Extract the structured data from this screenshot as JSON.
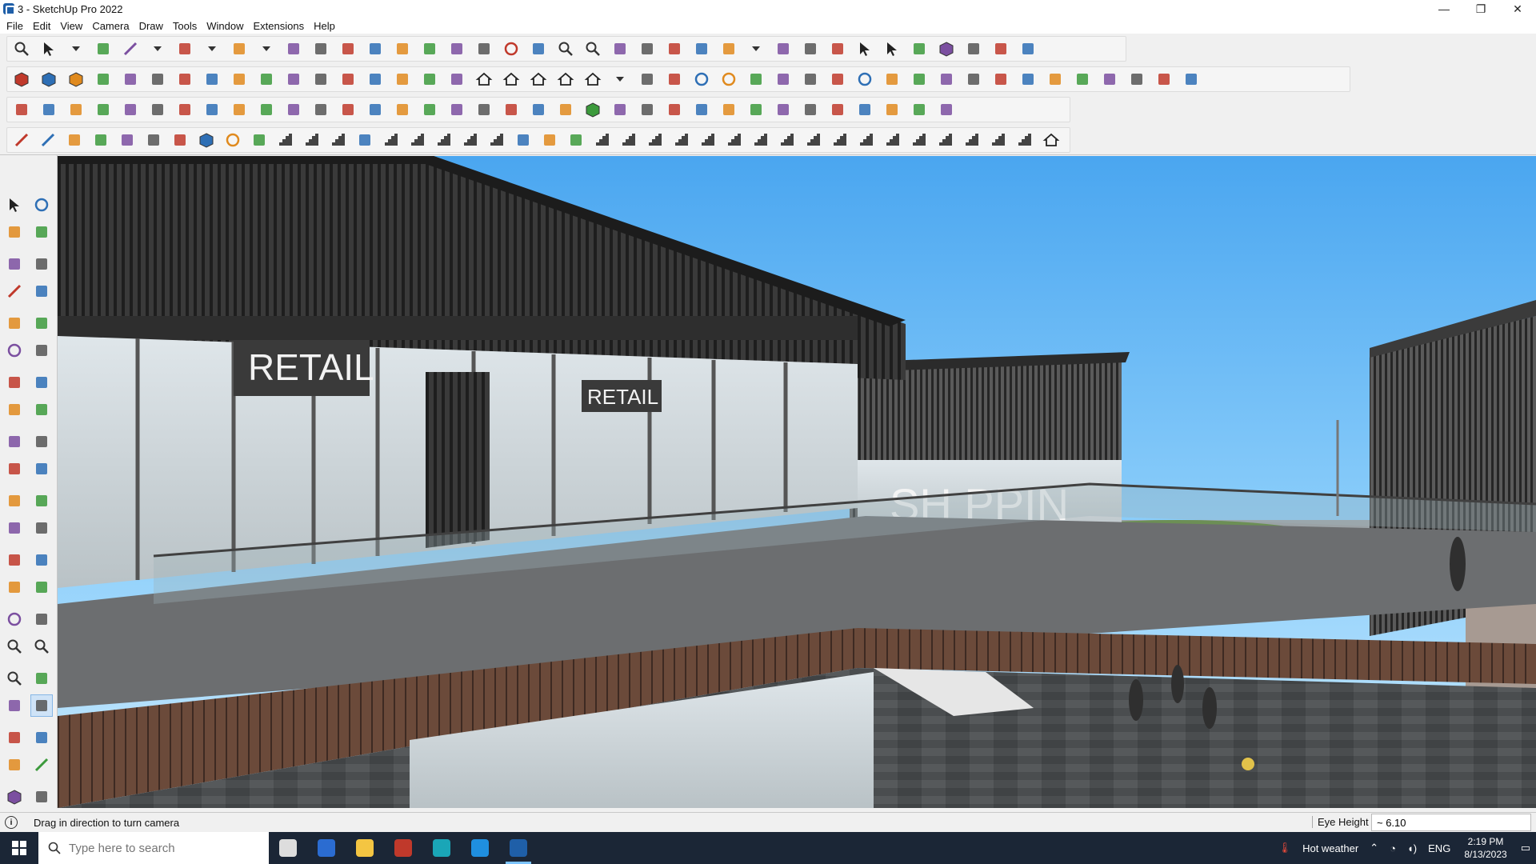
{
  "window": {
    "title": "3 - SketchUp Pro 2022",
    "controls": {
      "minimize": "—",
      "maximize": "❐",
      "close": "✕"
    }
  },
  "menu": [
    "File",
    "Edit",
    "View",
    "Camera",
    "Draw",
    "Tools",
    "Window",
    "Extensions",
    "Help"
  ],
  "viewport": {
    "signs": {
      "retail_large": "RETAIL",
      "retail_small": "RETAIL",
      "shopping": "SH PPIN"
    }
  },
  "statusbar": {
    "info_icon": "i",
    "hint": "Drag in direction to turn camera",
    "measurement_label": "Eye Height",
    "measurement_value": "~ 6.10"
  },
  "taskbar": {
    "search_placeholder": "Type here to search",
    "weather": "Hot weather",
    "language": "ENG",
    "time": "2:19 PM",
    "date": "8/13/2023"
  },
  "icons": {
    "toolbar_row1": [
      "zoom-icon",
      "select-arrow-icon",
      "dropdown-icon",
      "eraser-icon",
      "pencil-icon",
      "dropdown-icon",
      "lasso-icon",
      "dropdown-icon",
      "rect-icon",
      "dropdown-icon",
      "push-pull-icon",
      "follow-me-icon",
      "move-icon",
      "rotate-icon",
      "scale-icon",
      "tape-icon",
      "text-icon",
      "paint-icon",
      "orbit-icon",
      "pan-icon",
      "zoom-icon",
      "zoom-extents-icon",
      "camera-icon",
      "section-icon",
      "layers-icon",
      "tag-icon",
      "person-icon",
      "dropdown-icon",
      "component-icon",
      "component-icon",
      "flag-icon",
      "arrow-up-icon",
      "arrow-down-icon",
      "measure-icon",
      "sandbox-icon",
      "undo-icon",
      "redo-icon",
      "solid-icon"
    ],
    "toolbar_row2": [
      "box-icon",
      "box-icon",
      "box-icon",
      "extrude-icon",
      "shape-icon",
      "shape-icon",
      "shape-icon",
      "shape-icon",
      "shape-icon",
      "shape-icon",
      "shape-icon",
      "curve-icon",
      "section-plane-icon",
      "section-plane-icon",
      "section-plane-icon",
      "terrain-icon",
      "terrain-icon",
      "house-icon",
      "house-icon",
      "house-icon",
      "house-icon",
      "house-icon",
      "text-dropdown-icon",
      "curtain-icon",
      "brush-icon",
      "circle-icon",
      "circle-icon",
      "polygon-icon",
      "ellipse-icon",
      "parallelogram-icon",
      "arc-icon",
      "circle-icon",
      "lamp-icon",
      "curve-icon",
      "curve-icon",
      "slice-icon",
      "slice-icon",
      "warp-icon",
      "grid-icon",
      "mesh-icon",
      "mesh-icon",
      "mesh-icon",
      "mesh-icon",
      "mesh-icon"
    ],
    "toolbar_row3": [
      "plane-icon",
      "plane-icon",
      "plane-icon",
      "plane-icon",
      "plane-icon",
      "spiral-icon",
      "square-icon",
      "list-icon",
      "frame-icon",
      "chain-icon",
      "bend-icon",
      "bend-icon",
      "cross-icon",
      "star-icon",
      "crosshair-icon",
      "cone-icon",
      "pyramid-icon",
      "lasso-icon",
      "lasso-icon",
      "lasso-icon",
      "anchor-icon",
      "cube-icon",
      "loop-icon",
      "tree-icon",
      "split-icon",
      "split-icon",
      "tag-icon",
      "group-icon",
      "frame-icon",
      "grid-icon",
      "grid-icon",
      "grid-icon",
      "scatter-icon",
      "dots-icon",
      "group-icon"
    ],
    "toolbar_row4": [
      "draw-icon",
      "spline-icon",
      "bulb-icon",
      "trim-icon",
      "hex-icon",
      "hex-icon",
      "hook-icon",
      "cube-icon",
      "ring-icon",
      "fan-icon",
      "rail-icon",
      "rail-icon",
      "rail-icon",
      "curve-icon",
      "stairs-icon",
      "stairs-icon",
      "stairs-icon",
      "stairs-icon",
      "stairs-icon",
      "hand-icon",
      "shell-icon",
      "shell-icon",
      "stairs-icon",
      "stairs-icon",
      "stairs-icon",
      "stairs-icon",
      "stairs-icon",
      "stairs-icon",
      "stairs-icon",
      "stairs-icon",
      "stairs-icon",
      "stairs-icon",
      "stairs-icon",
      "stairs-icon",
      "stairs-icon",
      "stairs-icon",
      "stairs-icon",
      "stairs-icon",
      "stairs-icon",
      "house-icon"
    ],
    "left_toolbar": [
      "select-icon",
      "orbit-pen-icon",
      "paint-bucket-icon",
      "eraser-icon",
      "component-icon",
      "tape-icon",
      "line-icon",
      "freehand-icon",
      "rectangle-icon",
      "rotated-rect-icon",
      "circle-icon",
      "polygon-icon",
      "arc-icon",
      "pie-icon",
      "arc2-icon",
      "arc3-icon",
      "move-icon",
      "push-pull-icon",
      "rotate-icon",
      "follow-me-icon",
      "scale-icon",
      "offset-icon",
      "tape-measure-icon",
      "dimension-icon",
      "protractor-icon",
      "text-label-icon",
      "axes-icon",
      "3d-text-icon",
      "orbit-icon",
      "pan-icon",
      "zoom-icon",
      "zoom-window-icon",
      "zoom-extents-icon",
      "previous-view-icon",
      "walk-icon",
      "look-around-icon",
      "position-camera-icon",
      "section-plane-icon",
      "tag-layer-icon",
      "outliner-icon",
      "sandbox-icon",
      "stamp-icon"
    ],
    "taskbar_apps": [
      "task-view-icon",
      "calculator-icon",
      "file-explorer-icon",
      "acrobat-icon",
      "app-icon",
      "edge-icon",
      "sketchup-icon"
    ]
  }
}
